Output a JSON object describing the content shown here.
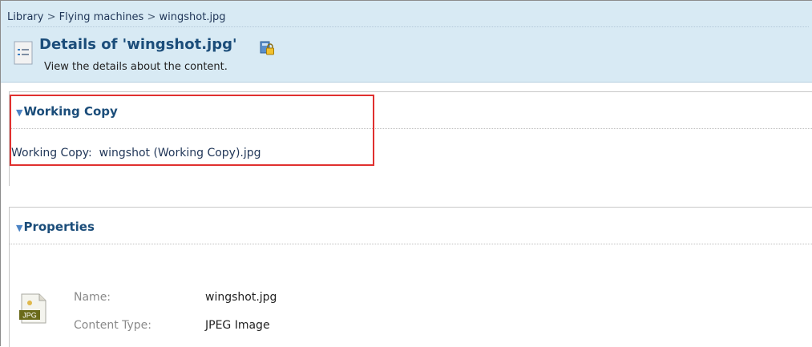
{
  "breadcrumb": {
    "items": [
      "Library",
      "Flying machines",
      "wingshot.jpg"
    ],
    "separator": ">"
  },
  "header": {
    "title": "Details of 'wingshot.jpg'",
    "subtitle": "View the details about the content."
  },
  "working_copy": {
    "section_title": "Working Copy",
    "label": "Working Copy:",
    "value": "wingshot (Working Copy).jpg"
  },
  "properties": {
    "section_title": "Properties",
    "file_badge": "JPG",
    "rows": [
      {
        "label": "Name:",
        "value": "wingshot.jpg"
      },
      {
        "label": "Content Type:",
        "value": "JPEG Image"
      }
    ]
  },
  "colors": {
    "header_bg": "#d8eaf4",
    "title": "#1b4d7a",
    "highlight_border": "#e0302f"
  }
}
